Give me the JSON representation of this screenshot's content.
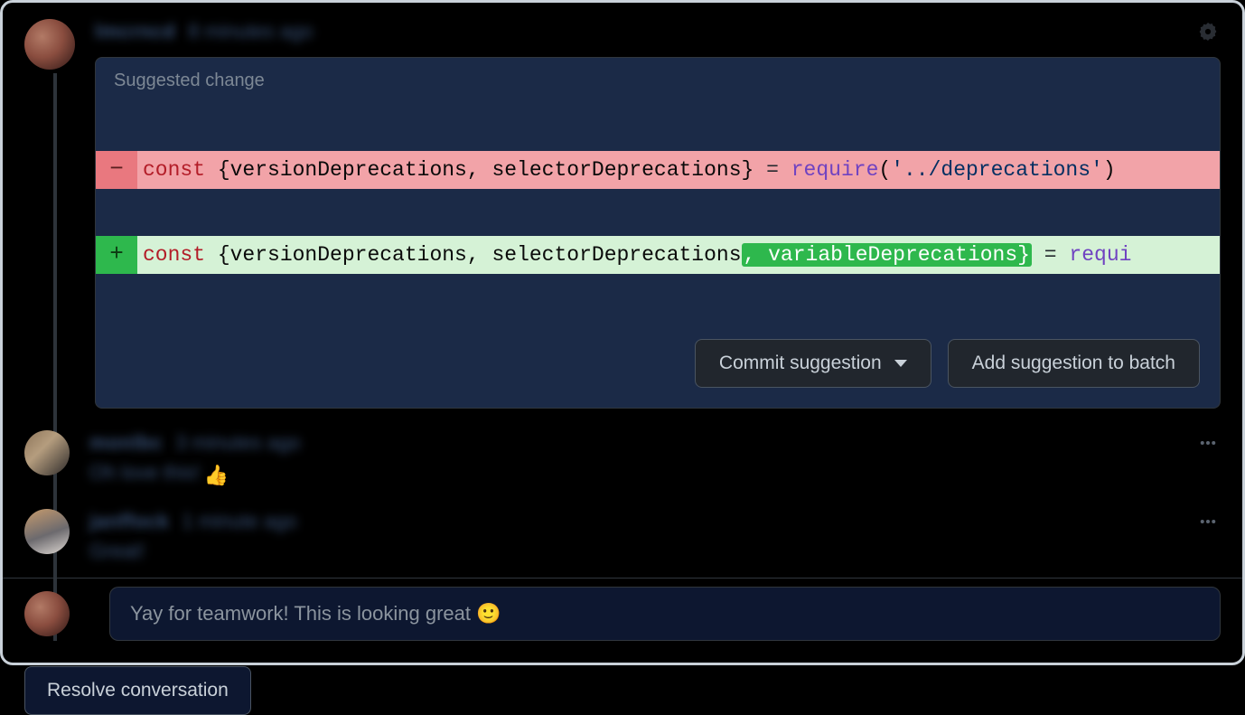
{
  "comments": [
    {
      "username": "lmcrncd",
      "timestamp": "8 minutes ago",
      "suggestion": {
        "header": "Suggested change",
        "removed_display": "const {versionDeprecations, selectorDeprecations} = require('../deprecations')",
        "added_display": "const {versionDeprecations, selectorDeprecations, variableDeprecations} = requi",
        "highlight_added": ", variableDeprecations}",
        "commit_label": "Commit suggestion",
        "batch_label": "Add suggestion to batch"
      }
    },
    {
      "username": "monlbc",
      "timestamp": "3 minutes ago",
      "text": "Oh love this!",
      "emoji": "👍"
    },
    {
      "username": "janffock",
      "timestamp": "1 minute ago",
      "text": "Great!"
    }
  ],
  "reply_placeholder": "Yay for teamwork! This is looking great 🙂",
  "resolve_label": "Resolve conversation"
}
